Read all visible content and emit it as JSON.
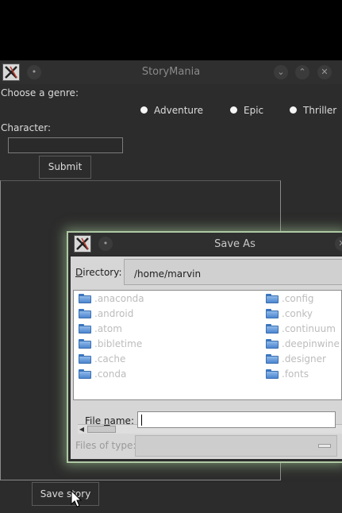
{
  "main_window": {
    "title": "StoryMania",
    "genre_label": "Choose a genre:",
    "genres": [
      "Adventure",
      "Epic",
      "Thriller"
    ],
    "character_label": "Character:",
    "character_value": "",
    "submit_label": "Submit",
    "save_label": "Save story"
  },
  "dialog": {
    "title": "Save As",
    "directory_label_u": "D",
    "directory_label_rest": "irectory:",
    "directory_value": "/home/marvin",
    "folders_left": [
      ".anaconda",
      ".android",
      ".atom",
      ".bibletime",
      ".cache",
      ".conda"
    ],
    "folders_right": [
      ".config",
      ".conky",
      ".continuum",
      ".deepinwine",
      ".designer",
      ".fonts"
    ],
    "file_name_label_pre": "File ",
    "file_name_label_u": "n",
    "file_name_label_post": "ame:",
    "file_name_value": "",
    "files_of_type_label": "Files of type:"
  },
  "icons": {
    "app": "x-app-icon",
    "folder": "folder-icon"
  },
  "colors": {
    "dialog_glow": "#aec8a4",
    "folder_blue": "#4d86cf",
    "window_bg": "#2c2c2c"
  }
}
